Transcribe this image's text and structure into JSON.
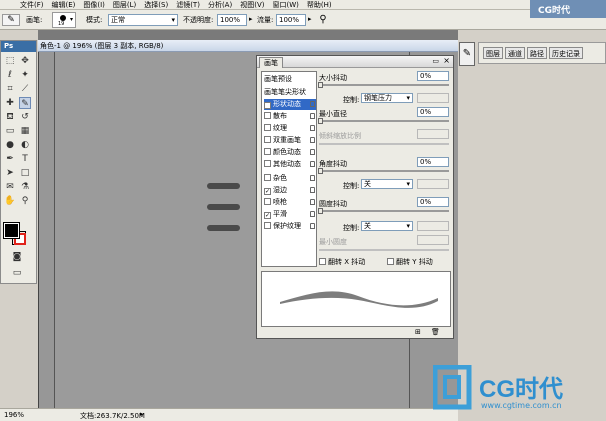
{
  "menu": [
    "文件(F)",
    "编辑(E)",
    "图像(I)",
    "图层(L)",
    "选择(S)",
    "滤镜(T)",
    "分析(A)",
    "视图(V)",
    "窗口(W)",
    "帮助(H)"
  ],
  "options": {
    "brush_label": "画笔:",
    "brush_size": "19",
    "mode_label": "模式:",
    "mode_value": "正常",
    "opacity_label": "不透明度:",
    "opacity_value": "100%",
    "flow_label": "流量:",
    "flow_value": "100%"
  },
  "document": {
    "title": "角色-1 @ 196% (图层 3 副本, RGB/8)",
    "zoom": "196%",
    "docinfo": "文档:263.7K/2.50M"
  },
  "toolbox": {
    "logo": "Ps"
  },
  "right_tabs": [
    "图层",
    "通道",
    "路径",
    "历史记录"
  ],
  "brush_panel": {
    "tab": "画笔",
    "list": [
      {
        "label": "画笔预设",
        "check": false,
        "lock": false,
        "header": true
      },
      {
        "label": "画笔笔尖形状",
        "check": false,
        "lock": false,
        "header": true
      },
      {
        "label": "形状动态",
        "check": true,
        "lock": true,
        "selected": true
      },
      {
        "label": "散布",
        "check": false,
        "lock": true
      },
      {
        "label": "纹理",
        "check": false,
        "lock": true
      },
      {
        "label": "双重画笔",
        "check": false,
        "lock": true
      },
      {
        "label": "颜色动态",
        "check": false,
        "lock": true
      },
      {
        "label": "其他动态",
        "check": false,
        "lock": true
      },
      {
        "label": "杂色",
        "check": false,
        "lock": true
      },
      {
        "label": "湿边",
        "check": true,
        "lock": true
      },
      {
        "label": "喷枪",
        "check": false,
        "lock": true
      },
      {
        "label": "平滑",
        "check": true,
        "lock": true
      },
      {
        "label": "保护纹理",
        "check": false,
        "lock": true
      }
    ],
    "size_jitter_label": "大小抖动",
    "size_jitter_value": "0%",
    "control_label": "控制:",
    "size_control": "钢笔压力",
    "min_diameter_label": "最小直径",
    "min_diameter_value": "0%",
    "tilt_scale_label": "倾斜缩放比例",
    "angle_jitter_label": "角度抖动",
    "angle_jitter_value": "0%",
    "angle_control": "关",
    "roundness_jitter_label": "圆度抖动",
    "roundness_jitter_value": "0%",
    "roundness_control": "关",
    "min_roundness_label": "最小圆度",
    "flip_x_label": "翻转 X 抖动",
    "flip_y_label": "翻转 Y 抖动"
  },
  "watermark": {
    "brand": "CG时代",
    "url": "www.cgtime.com.cn",
    "top_logo": "CG时代"
  },
  "colors": {
    "foreground": "#000000",
    "background": "#ffffff",
    "accent_red": "#e0231b",
    "selection": "#3169c6"
  }
}
